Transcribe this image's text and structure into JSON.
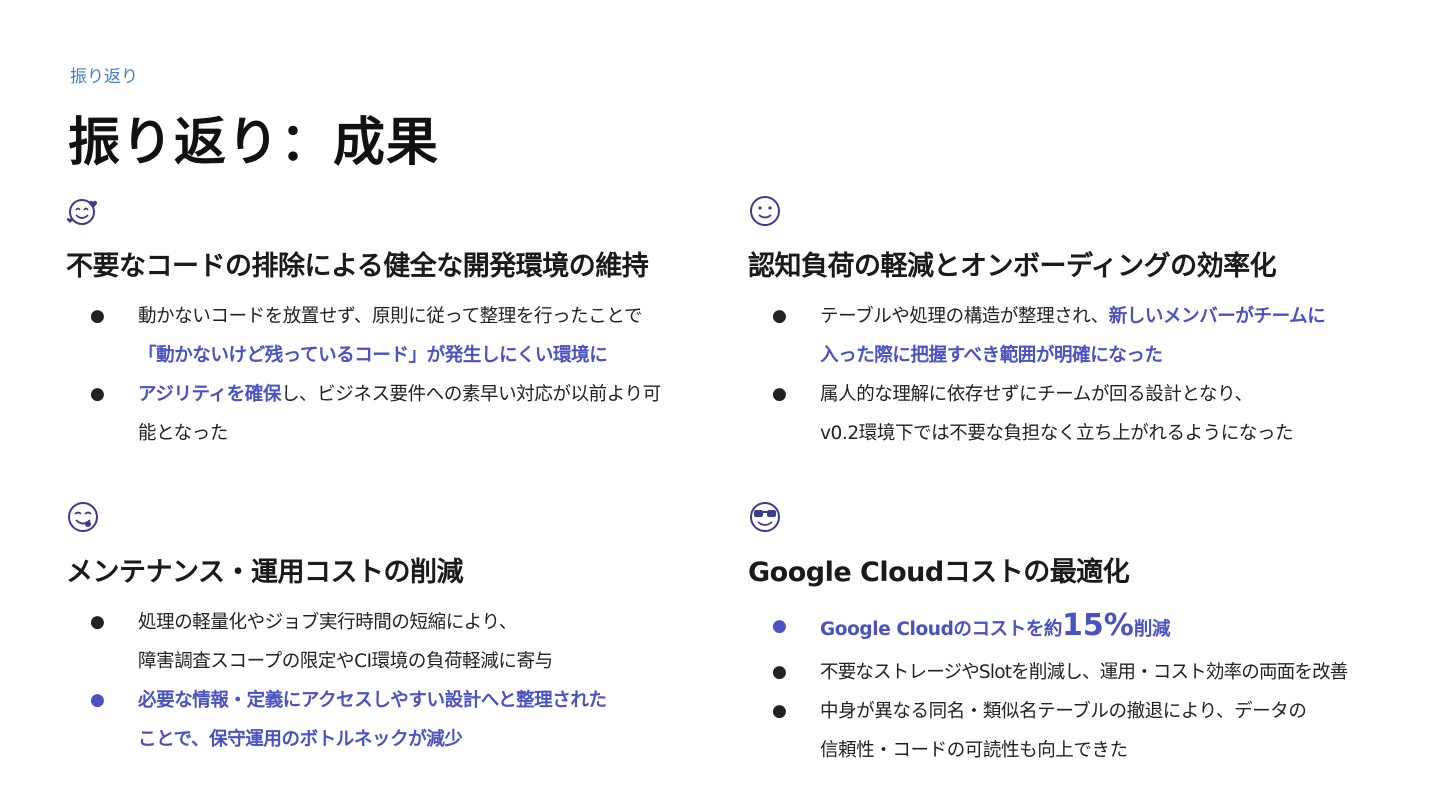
{
  "header": {
    "breadcrumb": "振り返り",
    "title": "振り返り：成果"
  },
  "colors": {
    "accent": "#4a52c2",
    "breadcrumb": "#3f7fd1",
    "text": "#222222"
  },
  "cards": {
    "c1": {
      "icon": "smiling-face-with-hearts-icon",
      "title": "不要なコードの排除による健全な開発環境の維持",
      "b1": {
        "line1": "動かないコードを放置せず、原則に従って整理を行ったことで",
        "line2": "「動かないけど残っているコード」が発生しにくい環境に"
      },
      "b2": {
        "hl": "アジリティを確保",
        "rest": "し、ビジネス要件への素早い対応が以前より可",
        "line2": "能となった"
      }
    },
    "c2": {
      "icon": "slightly-smiling-face-icon",
      "title": "認知負荷の軽減とオンボーディングの効率化",
      "b1": {
        "plain": "テーブルや処理の構造が整理され、",
        "hl1": "新しいメンバーがチームに",
        "hl2": "入った際に把握すべき範囲が明確になった"
      },
      "b2": {
        "line1": "属人的な理解に依存せずにチームが回る設計となり、",
        "line2": "v0.2環境下では不要な負担なく立ち上がれるようになった"
      }
    },
    "c3": {
      "icon": "face-savoring-food-icon",
      "title": "メンテナンス・運用コストの削減",
      "b1": {
        "line1": "処理の軽量化やジョブ実行時間の短縮により、",
        "line2": "障害調査スコープの限定やCI環境の負荷軽減に寄与"
      },
      "b2": {
        "line1": "必要な情報・定義にアクセスしやすい設計へと整理された",
        "line2": "ことで、保守運用のボトルネックが減少"
      }
    },
    "c4": {
      "icon": "smiling-face-with-sunglasses-icon",
      "title": "Google Cloudコストの最適化",
      "b1": {
        "pre": "Google Cloudのコストを約",
        "num": "15%",
        "post": "削減"
      },
      "b2": {
        "line1": "不要なストレージやSlotを削減し、運用・コスト効率の両面を改善"
      },
      "b3": {
        "line1": "中身が異なる同名・類似名テーブルの撤退により、データの",
        "line2": "信頼性・コードの可読性も向上できた"
      }
    }
  }
}
